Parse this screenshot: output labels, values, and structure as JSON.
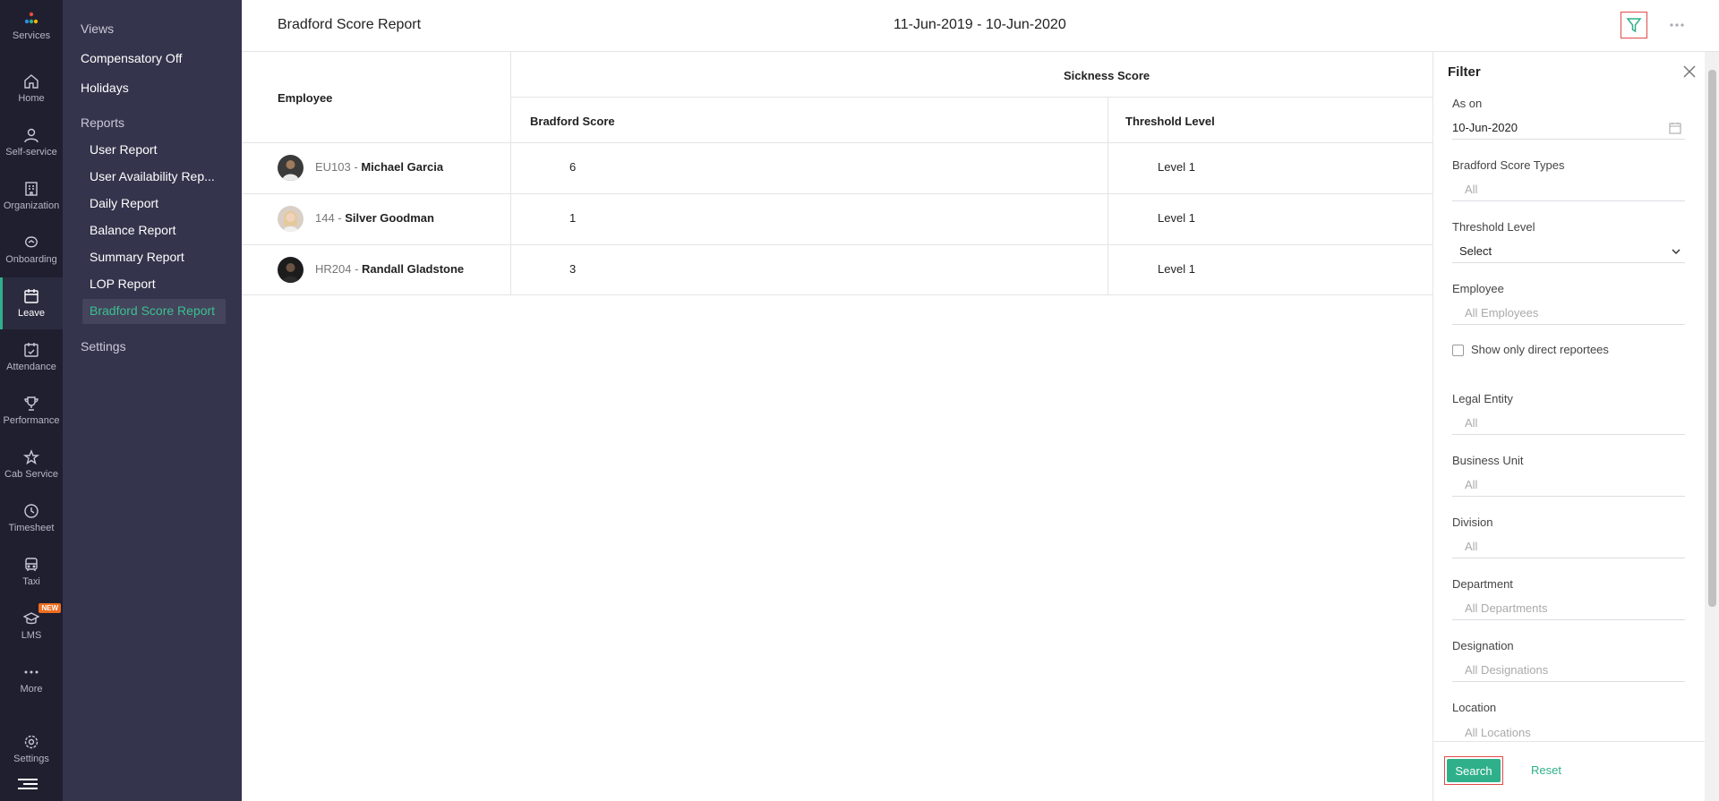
{
  "rail": {
    "items": [
      {
        "label": "Services",
        "icon": "services-icon"
      },
      {
        "label": "Home",
        "icon": "home-icon"
      },
      {
        "label": "Self-service",
        "icon": "user-icon"
      },
      {
        "label": "Organization",
        "icon": "organization-icon"
      },
      {
        "label": "Onboarding",
        "icon": "onboarding-icon"
      },
      {
        "label": "Leave",
        "icon": "leave-icon"
      },
      {
        "label": "Attendance",
        "icon": "attendance-icon"
      },
      {
        "label": "Performance",
        "icon": "trophy-icon"
      },
      {
        "label": "Cab Service",
        "icon": "star-icon"
      },
      {
        "label": "Timesheet",
        "icon": "clock-icon"
      },
      {
        "label": "Taxi",
        "icon": "bus-icon"
      },
      {
        "label": "LMS",
        "icon": "graduation-icon"
      },
      {
        "label": "More",
        "icon": "more-icon"
      },
      {
        "label": "Settings",
        "icon": "gear-icon"
      }
    ],
    "new_badge": "NEW"
  },
  "subnav": {
    "views_label": "Views",
    "compensatory": "Compensatory Off",
    "holidays": "Holidays",
    "reports_label": "Reports",
    "reports": [
      "User Report",
      "User Availability Rep...",
      "Daily Report",
      "Balance Report",
      "Summary Report",
      "LOP Report",
      "Bradford Score Report"
    ],
    "settings_label": "Settings"
  },
  "header": {
    "title": "Bradford Score Report",
    "range": "11-Jun-2019 - 10-Jun-2020"
  },
  "table": {
    "employee_header": "Employee",
    "group_header": "Sickness Score",
    "bradford_header": "Bradford Score",
    "threshold_header": "Threshold Level",
    "rows": [
      {
        "id": "EU103 - ",
        "name": "Michael Garcia",
        "score": "6",
        "level": "Level 1"
      },
      {
        "id": "144 - ",
        "name": "Silver Goodman",
        "score": "1",
        "level": "Level 1"
      },
      {
        "id": "HR204 - ",
        "name": "Randall Gladstone",
        "score": "3",
        "level": "Level 1"
      }
    ]
  },
  "filter": {
    "title": "Filter",
    "as_on_label": "As on",
    "as_on_value": "10-Jun-2020",
    "types_label": "Bradford Score Types",
    "types_value": "All",
    "threshold_label": "Threshold Level",
    "threshold_value": "Select",
    "employee_label": "Employee",
    "employee_value": "All Employees",
    "direct_label": "Show only direct reportees",
    "legal_label": "Legal Entity",
    "legal_value": "All",
    "bu_label": "Business Unit",
    "bu_value": "All",
    "division_label": "Division",
    "division_value": "All",
    "department_label": "Department",
    "department_value": "All Departments",
    "designation_label": "Designation",
    "designation_value": "All Designations",
    "location_label": "Location",
    "location_value": "All Locations",
    "search": "Search",
    "reset": "Reset"
  },
  "colors": {
    "accent": "#2fb08a",
    "highlight": "#e24949",
    "rail": "#1f1f30",
    "subnav": "#34344d"
  }
}
